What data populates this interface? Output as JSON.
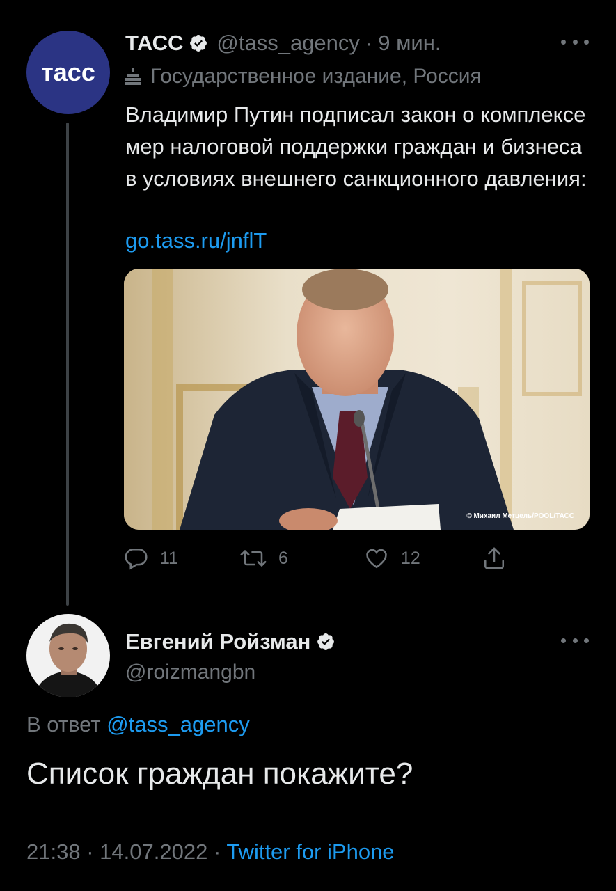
{
  "parent_tweet": {
    "avatar_text": "тасс",
    "name": "ТАСС",
    "handle": "@tass_agency",
    "separator": "·",
    "time": "9 мин.",
    "label": "Государственное издание, Россия",
    "text": "Владимир Путин подписал закон о комплексе мер налоговой поддержки граждан и бизнеса в условиях внешнего санкционного давления:",
    "link": "go.tass.ru/jnflT",
    "media": {
      "caption": "© Михаил Метцель/POOL/ТАСС"
    },
    "actions": {
      "replies": "11",
      "retweets": "6",
      "likes": "12"
    }
  },
  "reply_tweet": {
    "name": "Евгений Ройзман",
    "handle": "@roizmangbn",
    "reply_prefix": "В ответ",
    "reply_mention": "@tass_agency",
    "text": "Список граждан покажите?",
    "time": "21:38",
    "separator": "·",
    "date": "14.07.2022",
    "source": "Twitter for iPhone"
  },
  "colors": {
    "background": "#000000",
    "text_primary": "#e7e9ea",
    "text_secondary": "#71767b",
    "link": "#1d9bf0",
    "tass_brand": "#2b3484"
  },
  "icons": [
    "verified-badge-icon",
    "government-building-icon",
    "more-icon",
    "reply-icon",
    "retweet-icon",
    "like-icon",
    "share-icon"
  ]
}
